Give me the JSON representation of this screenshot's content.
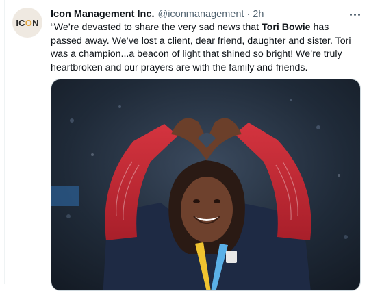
{
  "tweet": {
    "author_name": "Icon Management Inc.",
    "author_handle": "@iconmanagement",
    "separator": "·",
    "timestamp": "2h",
    "avatar": {
      "text_before": "IC",
      "text_o": "O",
      "text_after": "N"
    },
    "text": {
      "part1": "“We’re devasted to share the very sad news that ",
      "highlight": "Tori Bowie",
      "part2": " has passed away. We’ve lost a client, dear friend, daughter and sister. Tori was a champion...a beacon of light that shined so bright! We’re truly heartbroken and our prayers are with the family and friends."
    },
    "media_icon": "photo-athlete-heart-hands"
  },
  "colors": {
    "text": "#0f1419",
    "secondary": "#536471",
    "avatar_bg": "#efe9e1",
    "avatar_accent": "#e0a13a"
  },
  "icons": {
    "more": "more-options-icon"
  }
}
